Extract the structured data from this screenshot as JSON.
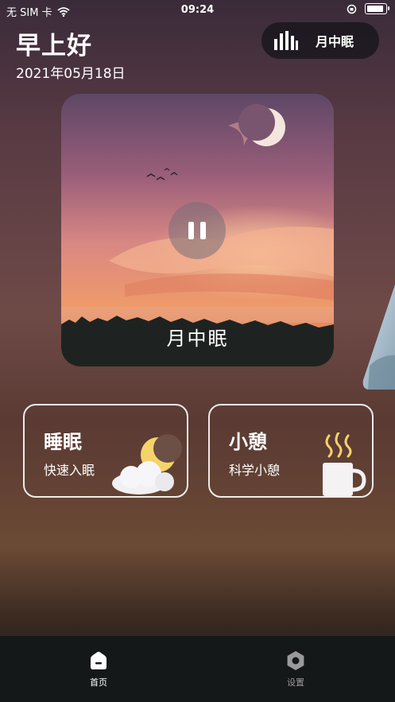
{
  "status_bar": {
    "carrier": "无 SIM 卡",
    "time": "09:24",
    "wifi_icon": "wifi-icon",
    "orientation_lock_icon": "orientation-lock-icon",
    "battery_icon": "battery-icon"
  },
  "header": {
    "greeting": "早上好",
    "date": "2021年05月18日"
  },
  "now_playing": {
    "label": "月中眠",
    "icon": "equalizer-bars-icon"
  },
  "featured": {
    "title": "月中眠",
    "pause_icon": "pause-icon"
  },
  "modes": [
    {
      "title": "睡眠",
      "subtitle": "快速入眠",
      "icon": "moon-cloud-icon"
    },
    {
      "title": "小憩",
      "subtitle": "科学小憩",
      "icon": "steaming-mug-icon"
    }
  ],
  "tabbar": {
    "items": [
      {
        "label": "首页",
        "icon": "home-icon",
        "active": true
      },
      {
        "label": "设置",
        "icon": "settings-hexagon-icon",
        "active": false
      }
    ]
  },
  "colors": {
    "accent_moon": "#f5d36b",
    "tab_active": "#ffffff",
    "tab_inactive": "#9a9a9a"
  }
}
